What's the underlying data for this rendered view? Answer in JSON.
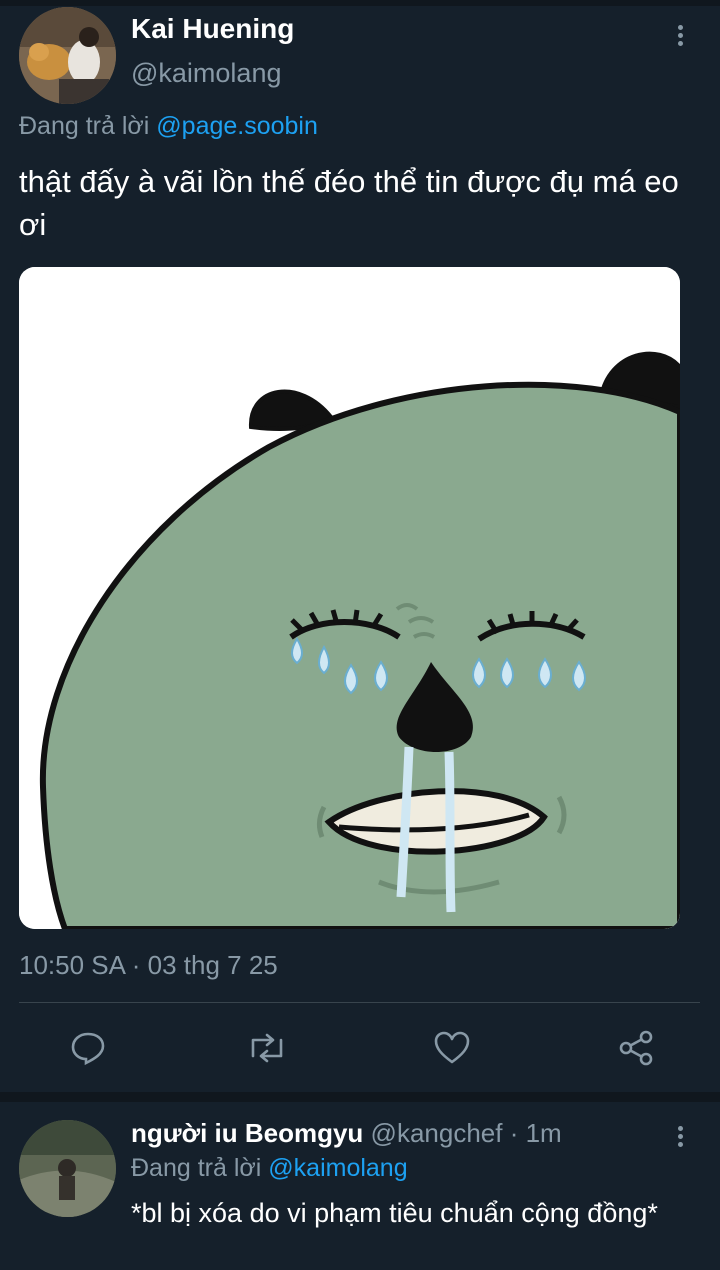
{
  "tweet": {
    "author_name": "Kai Huening",
    "author_handle": "@kaimolang",
    "replying_prefix": "Đang trả lời ",
    "replying_to": "@page.soobin",
    "text": "thật đấy à vãi lồn thế đéo thể tin được đụ má eo ơi",
    "timestamp": "10:50 SA · 03 thg 7 25"
  },
  "actions": [
    {
      "icon": "reply-icon"
    },
    {
      "icon": "retweet-icon"
    },
    {
      "icon": "like-icon"
    },
    {
      "icon": "share-icon"
    }
  ],
  "reply": {
    "author_name": "người iu Beomgyu",
    "author_handle": "@kangchef",
    "time": " · 1m",
    "replying_prefix": "Đang trả lời ",
    "replying_to": "@kaimolang",
    "text": "*bl bị xóa do vi phạm tiêu chuẩn cộng đồng*"
  },
  "colors": {
    "background": "#15202b",
    "accent": "#1da1f2",
    "muted": "#8899a6",
    "divider": "#38444d"
  }
}
